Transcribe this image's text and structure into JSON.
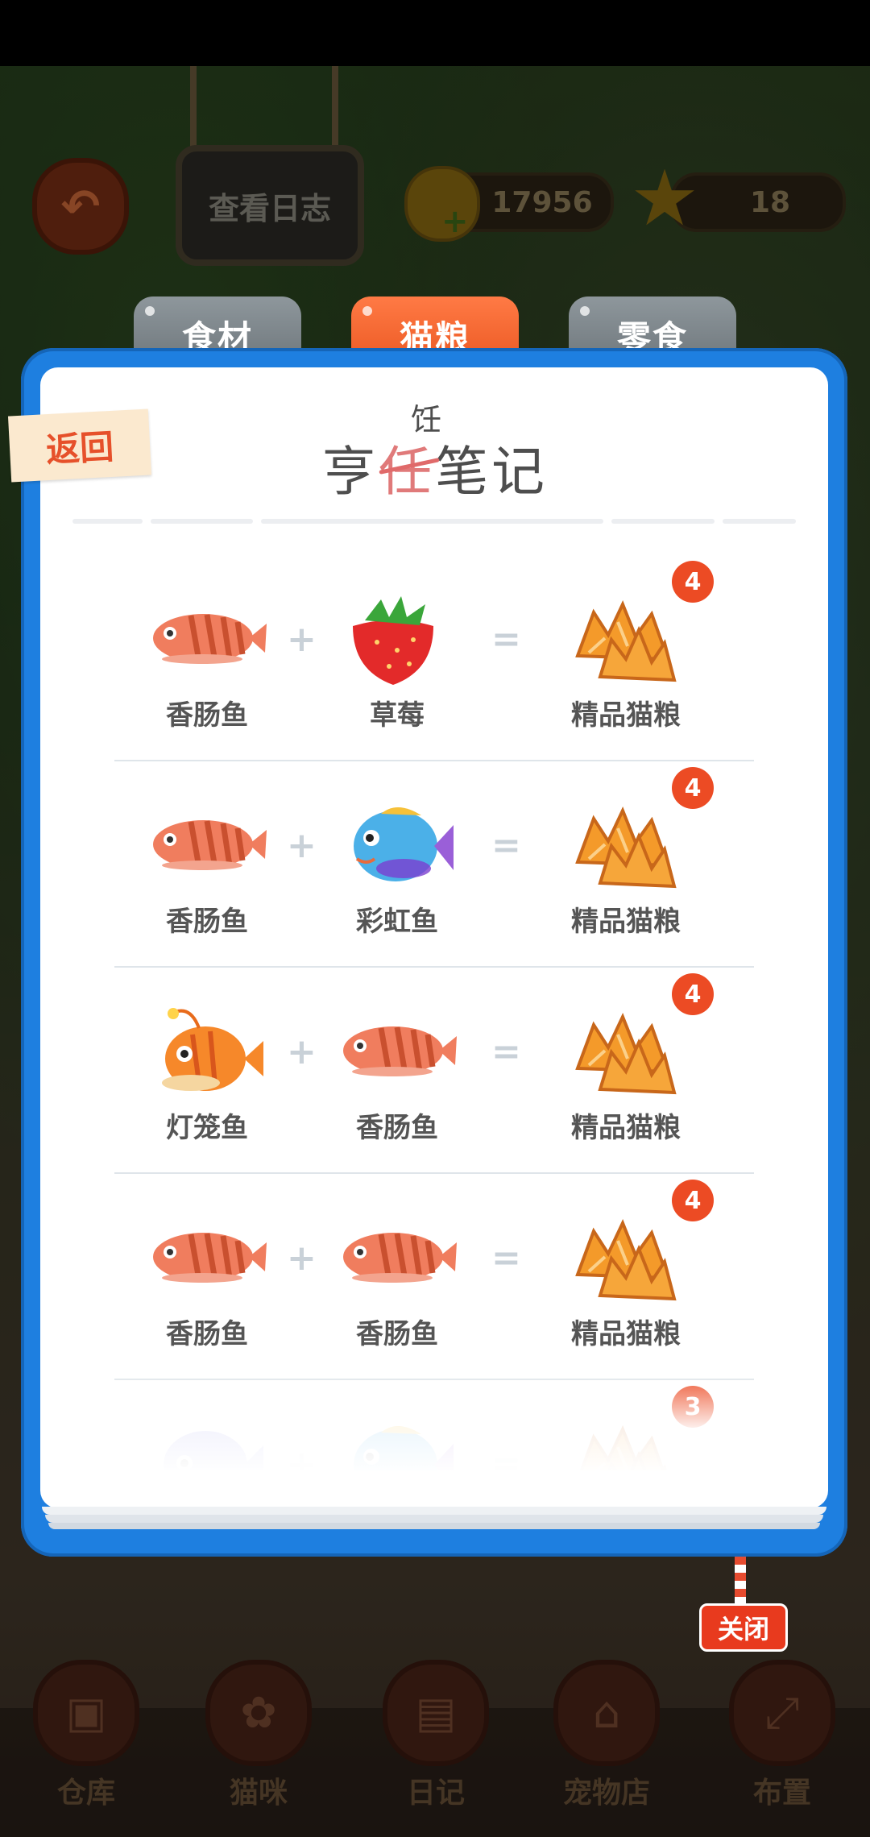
{
  "hud": {
    "log_label": "查看日志",
    "coins": "17956",
    "stars": "18"
  },
  "tabs": [
    {
      "label": "食材",
      "active": false
    },
    {
      "label": "猫粮",
      "active": true
    },
    {
      "label": "零食",
      "active": false
    }
  ],
  "modal": {
    "back_label": "返回",
    "title": "烹饪笔记",
    "title_chars": [
      "亨",
      "任",
      "笔记"
    ],
    "title_correction": "饪",
    "close_label": "关闭"
  },
  "recipes": [
    {
      "a": "香肠鱼",
      "a_icon": "sausage-fish",
      "b": "草莓",
      "b_icon": "strawberry",
      "result": "精品猫粮",
      "result_icon": "premium-cat-food",
      "count": "4"
    },
    {
      "a": "香肠鱼",
      "a_icon": "sausage-fish",
      "b": "彩虹鱼",
      "b_icon": "rainbow-fish",
      "result": "精品猫粮",
      "result_icon": "premium-cat-food",
      "count": "4"
    },
    {
      "a": "灯笼鱼",
      "a_icon": "lantern-fish",
      "b": "香肠鱼",
      "b_icon": "sausage-fish",
      "result": "精品猫粮",
      "result_icon": "premium-cat-food",
      "count": "4"
    },
    {
      "a": "香肠鱼",
      "a_icon": "sausage-fish",
      "b": "香肠鱼",
      "b_icon": "sausage-fish",
      "result": "精品猫粮",
      "result_icon": "premium-cat-food",
      "count": "4"
    },
    {
      "a": "",
      "a_icon": "purple-fish",
      "b": "",
      "b_icon": "rainbow-fish",
      "result": "",
      "result_icon": "premium-cat-food",
      "count": "3"
    }
  ],
  "symbols": {
    "plus": "+",
    "equals": "="
  },
  "bottom_nav": [
    {
      "label": "仓库",
      "icon": "box-icon"
    },
    {
      "label": "猫咪",
      "icon": "paw-icon"
    },
    {
      "label": "日记",
      "icon": "notebook-icon"
    },
    {
      "label": "宠物店",
      "icon": "shop-icon"
    },
    {
      "label": "布置",
      "icon": "expand-icon"
    }
  ]
}
